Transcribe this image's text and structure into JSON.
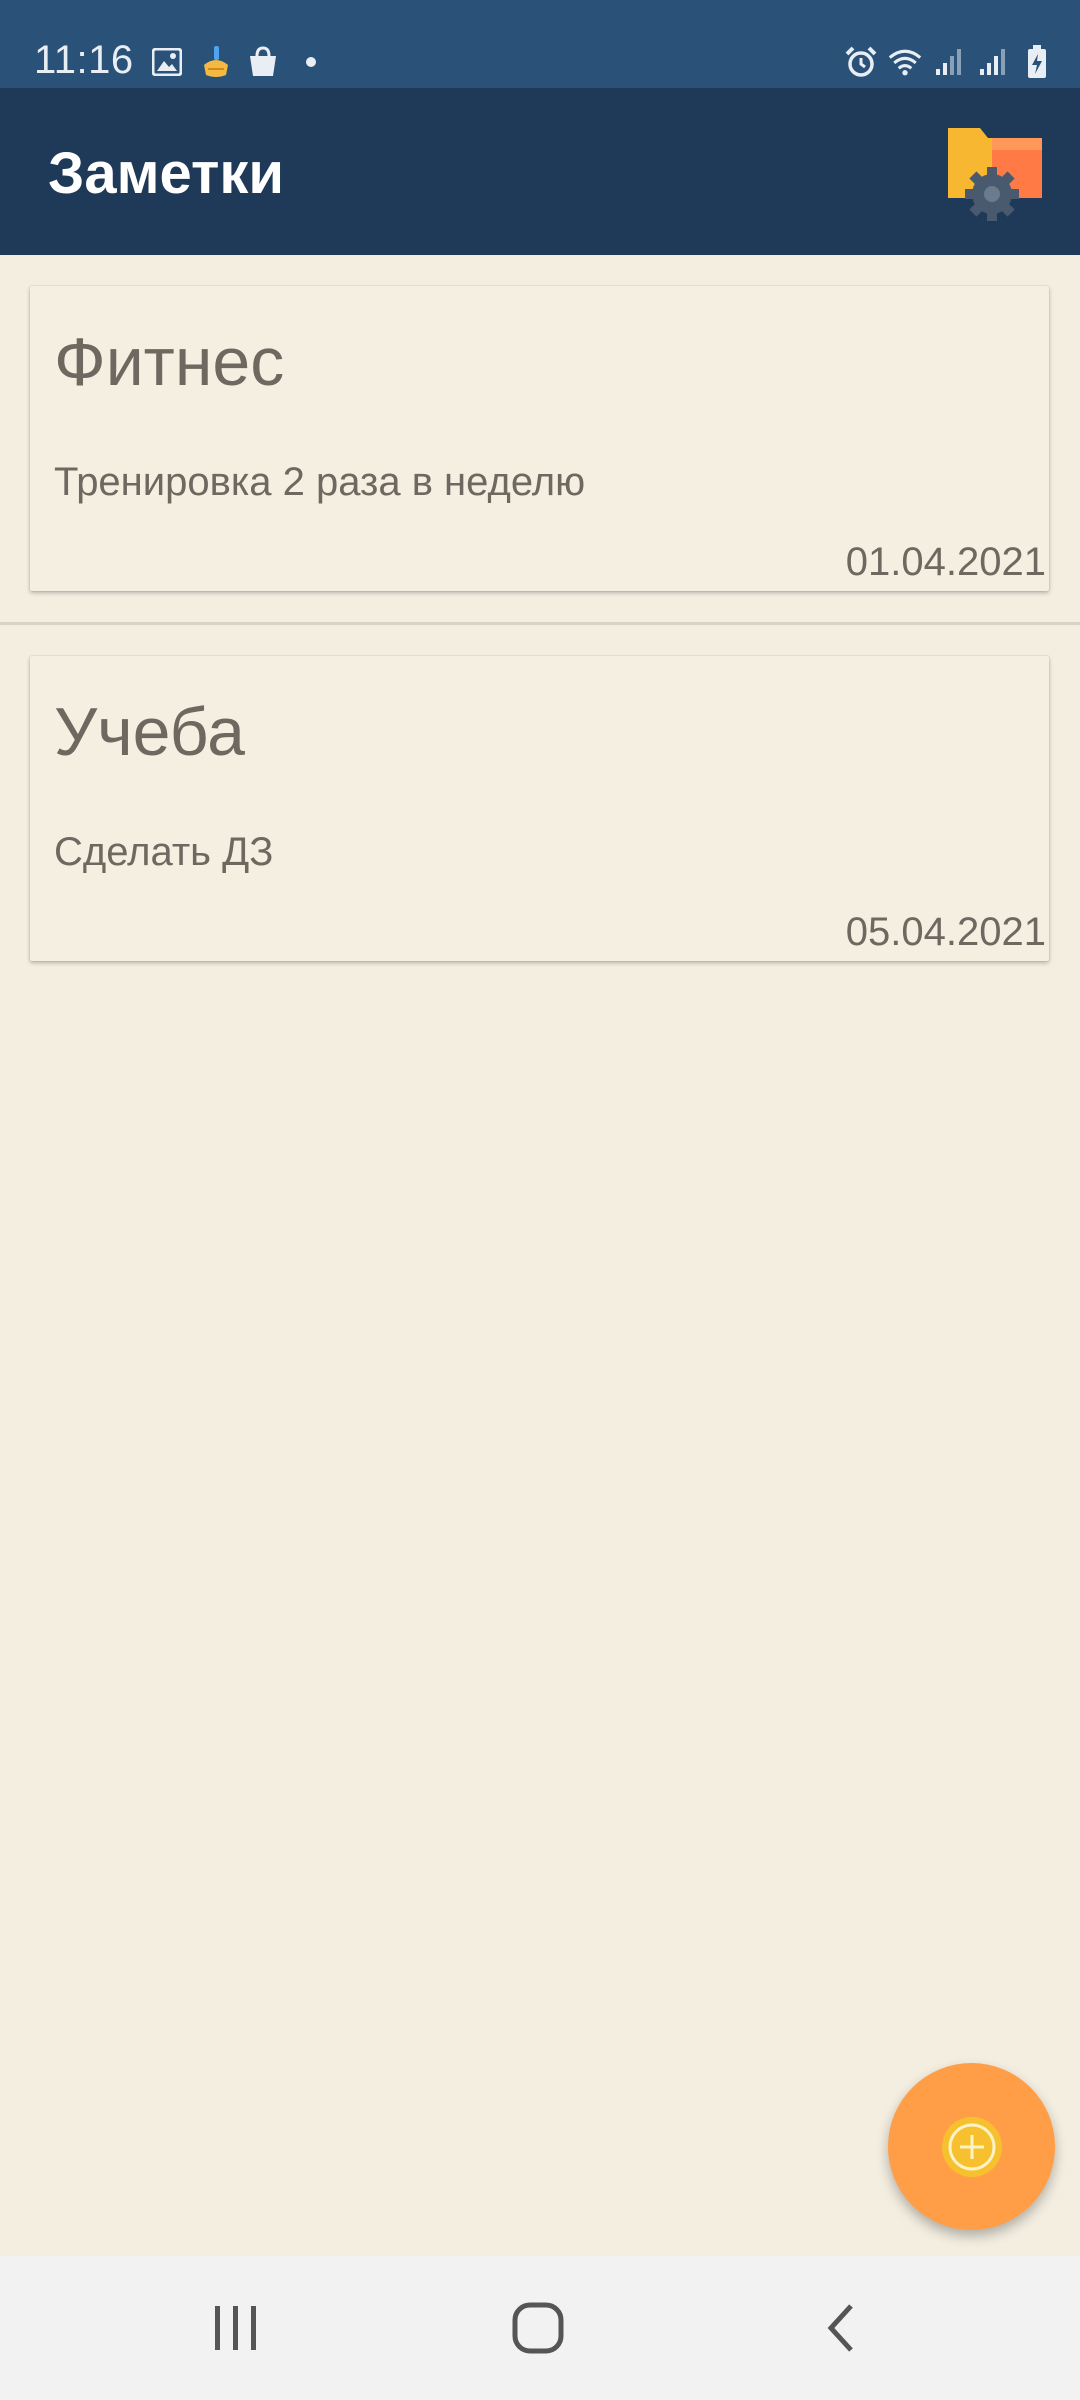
{
  "status_bar": {
    "time": "11:16",
    "left_icons": [
      "image-icon",
      "cleaner-icon",
      "shopping-bag-icon",
      "notification-dot-icon"
    ],
    "right_icons": [
      "alarm-icon",
      "wifi-icon",
      "signal-icon",
      "signal-icon",
      "battery-charging-icon"
    ]
  },
  "app_bar": {
    "title": "Заметки",
    "action_icon": "folder-settings-icon"
  },
  "notes": [
    {
      "title": "Фитнес",
      "body": "Тренировка 2 раза в неделю",
      "date": "01.04.2021"
    },
    {
      "title": "Учеба",
      "body": "Сделать ДЗ",
      "date": "05.04.2021"
    }
  ],
  "fab": {
    "icon": "add-circle-icon",
    "color": "#ff9e46"
  },
  "nav_bar": {
    "buttons": [
      "recents-icon",
      "home-icon",
      "back-icon"
    ]
  },
  "colors": {
    "status_bar": "#2a5278",
    "app_bar": "#1f3a58",
    "background": "#f4eee1",
    "card": "#f5efe2",
    "text": "#6d6860"
  }
}
